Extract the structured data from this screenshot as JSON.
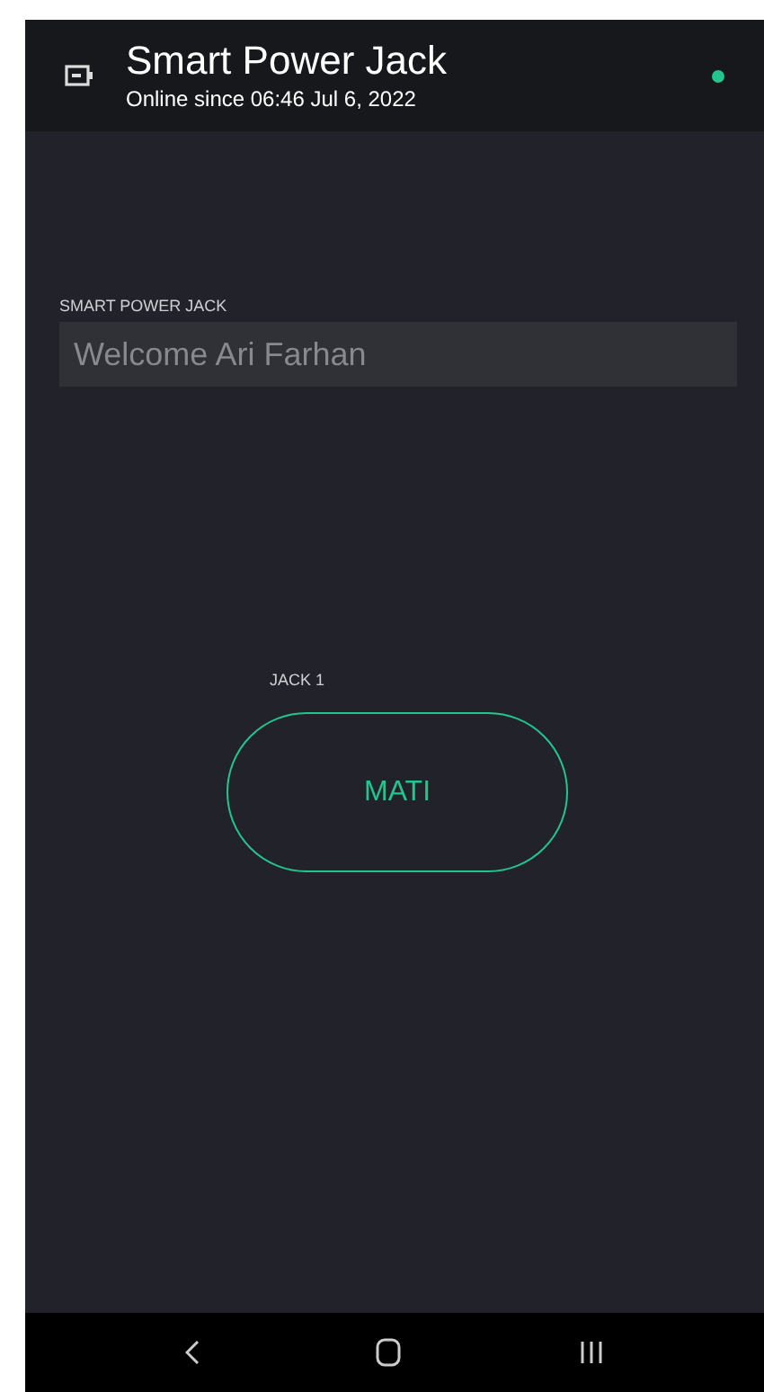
{
  "header": {
    "title": "Smart Power Jack",
    "subtitle": "Online since 06:46 Jul 6, 2022",
    "online": true
  },
  "display": {
    "label": "SMART POWER JACK",
    "value": "Welcome Ari Farhan"
  },
  "switch": {
    "label": "JACK 1",
    "text": "MATI",
    "on": false
  }
}
